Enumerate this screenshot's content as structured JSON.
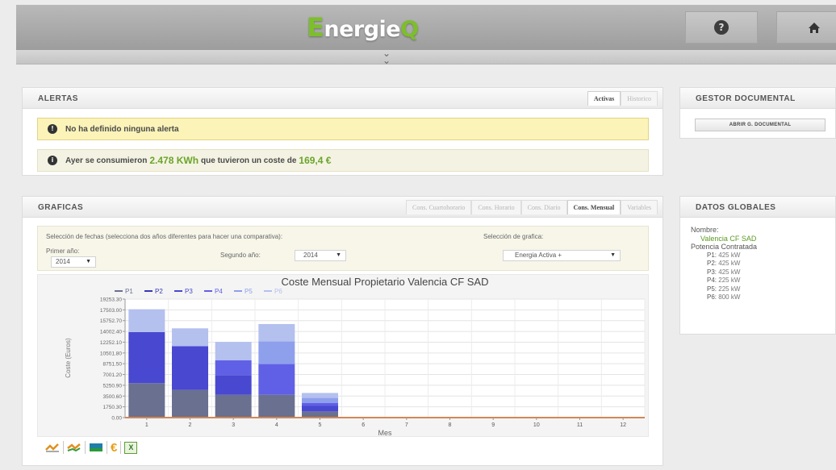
{
  "header": {
    "logo_e": "E",
    "logo_mid": "nergie",
    "logo_q": "Q",
    "help_icon": "help-circle-icon",
    "home_icon": "home-icon",
    "expand_icon": "chevron-double-down-icon"
  },
  "alertas": {
    "title": "ALERTAS",
    "tabs": [
      {
        "label": "Activas",
        "active": true
      },
      {
        "label": "Historico",
        "active": false
      }
    ],
    "warning": "No ha definido ninguna alerta",
    "info_prefix": "Ayer se consumieron",
    "info_kwh": "2.478 KWh",
    "info_mid": "que tuvieron un coste de",
    "info_cost": "169,4 €"
  },
  "gestor": {
    "title": "GESTOR DOCUMENTAL",
    "button": "ABRIR G. DOCUMENTAL"
  },
  "graficas": {
    "title": "GRAFICAS",
    "tabs": [
      {
        "label": "Cons. Cuartohorario",
        "active": false
      },
      {
        "label": "Cons. Horario",
        "active": false
      },
      {
        "label": "Cons. Diario",
        "active": false
      },
      {
        "label": "Cons. Mensual",
        "active": true
      },
      {
        "label": "Variables",
        "active": false
      }
    ],
    "filters": {
      "dates_hint": "Selección de fechas (selecciona dos años diferentes para hacer una comparativa):",
      "chart_hint": "Selección de grafica:",
      "first_year_label": "Primer año:",
      "first_year_value": "2014",
      "second_year_label": "Segundo año:",
      "second_year_value": "2014",
      "chart_select_value": "Energia Activa +"
    },
    "toolbar_icons": [
      "chart-line-icon",
      "chart-compare-icon",
      "chart-area-icon",
      "euro-icon",
      "excel-export-icon"
    ],
    "euro_symbol": "€",
    "excel_label": "X"
  },
  "datos": {
    "title": "DATOS GLOBALES",
    "nombre_label": "Nombre:",
    "nombre_value": "Valencia CF SAD",
    "potencia_label": "Potencia Contratada",
    "potencias": [
      {
        "p": "P1:",
        "v": "425 kW"
      },
      {
        "p": "P2:",
        "v": "425 kW"
      },
      {
        "p": "P3:",
        "v": "425 kW"
      },
      {
        "p": "P4:",
        "v": "225 kW"
      },
      {
        "p": "P5:",
        "v": "225 kW"
      },
      {
        "p": "P6:",
        "v": "800 kW"
      }
    ]
  },
  "chart_data": {
    "type": "bar",
    "title": "Coste Mensual Propietario Valencia CF SAD",
    "xlabel": "Mes",
    "ylabel": "Coste (Euros)",
    "categories": [
      "1",
      "2",
      "3",
      "4",
      "5",
      "6",
      "7",
      "8",
      "9",
      "10",
      "11",
      "12"
    ],
    "yticks": [
      "0.00",
      "1750.30",
      "3500.60",
      "5250.90",
      "7001.20",
      "8751.50",
      "10501.80",
      "12252.10",
      "14002.40",
      "15752.70",
      "17503.00",
      "19253.30"
    ],
    "ylim": [
      0,
      19253.3
    ],
    "stacked": true,
    "grid": true,
    "legend_position": "top",
    "series": [
      {
        "name": "P1",
        "color": "#6a7090",
        "values": [
          5600,
          4500,
          3700,
          3700,
          1000,
          0,
          0,
          0,
          0,
          0,
          0,
          0
        ]
      },
      {
        "name": "P2",
        "color": "#3838b4",
        "values": [
          0,
          0,
          0,
          0,
          0,
          0,
          0,
          0,
          0,
          0,
          0,
          0
        ]
      },
      {
        "name": "P3",
        "color": "#4848d0",
        "values": [
          8300,
          7100,
          3200,
          0,
          900,
          0,
          0,
          0,
          0,
          0,
          0,
          0
        ]
      },
      {
        "name": "P4",
        "color": "#6060e6",
        "values": [
          0,
          0,
          2400,
          5000,
          500,
          0,
          0,
          0,
          0,
          0,
          0,
          0
        ]
      },
      {
        "name": "P5",
        "color": "#8ea0ec",
        "values": [
          0,
          0,
          0,
          3700,
          800,
          0,
          0,
          0,
          0,
          0,
          0,
          0
        ]
      },
      {
        "name": "P6",
        "color": "#b4c0ee",
        "values": [
          3700,
          2900,
          3000,
          2800,
          800,
          0,
          0,
          0,
          0,
          0,
          0,
          0
        ]
      }
    ]
  }
}
